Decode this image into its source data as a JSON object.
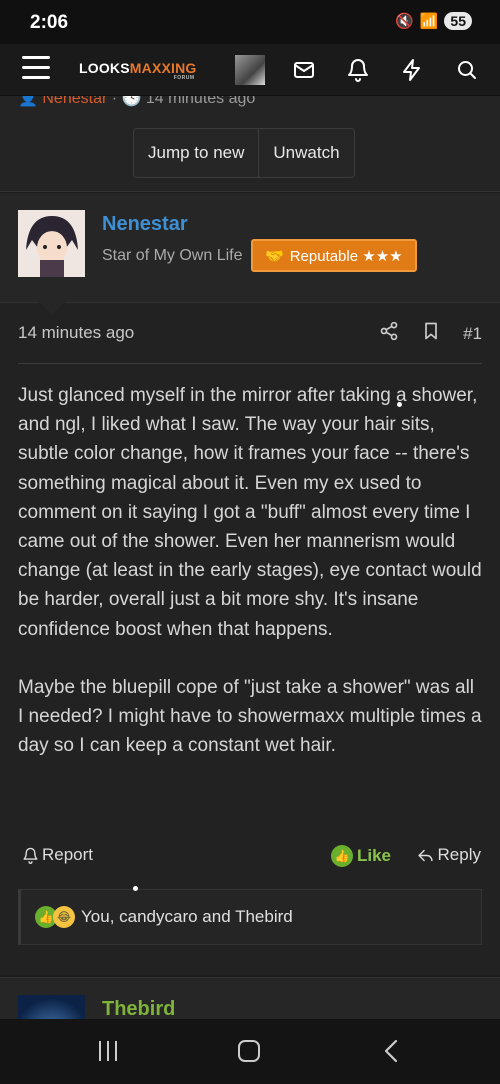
{
  "status_bar": {
    "time": "2:06",
    "battery": "55"
  },
  "header": {
    "logo_main": "LOOKS",
    "logo_accent": "MAXXING",
    "logo_sub": "FORUM",
    "icons": [
      "menu-icon",
      "avatar",
      "inbox-icon",
      "bell-icon",
      "bolt-icon",
      "search-icon"
    ]
  },
  "thread_meta": {
    "username": "Nenestar",
    "time": "14 minutes ago",
    "jump_label": "Jump to new",
    "unwatch_label": "Unwatch"
  },
  "post": {
    "username": "Nenestar",
    "user_title": "Star of My Own Life",
    "badge": "Reputable ★★★",
    "date": "14 minutes ago",
    "number": "#1",
    "body": [
      "Just glanced myself in the mirror after taking a shower, and ngl, I liked what I saw. The way your hair sits, subtle color change, how it frames your face -- there's something magical about it. Even my ex used to comment on it saying I got a \"buff\" almost every time I came out of the shower. Even her mannerism would change (at least in the early stages), eye contact would be harder, overall just a bit more shy. It's insane confidence boost when that happens.",
      "Maybe the bluepill cope of \"just take a shower\" was all I needed? I might have to showermaxx multiple times a day so I can keep a constant wet hair."
    ],
    "report_label": "Report",
    "like_label": "Like",
    "reply_label": "Reply",
    "reactions_text": "You, candycaro and Thebird"
  },
  "next_post": {
    "username": "Thebird"
  },
  "colors": {
    "accent": "#e8782a",
    "username_blue": "#3f8fd4",
    "like_green": "#8bc34a",
    "badge_orange": "#e07b15",
    "next_username": "#7fb33a"
  }
}
